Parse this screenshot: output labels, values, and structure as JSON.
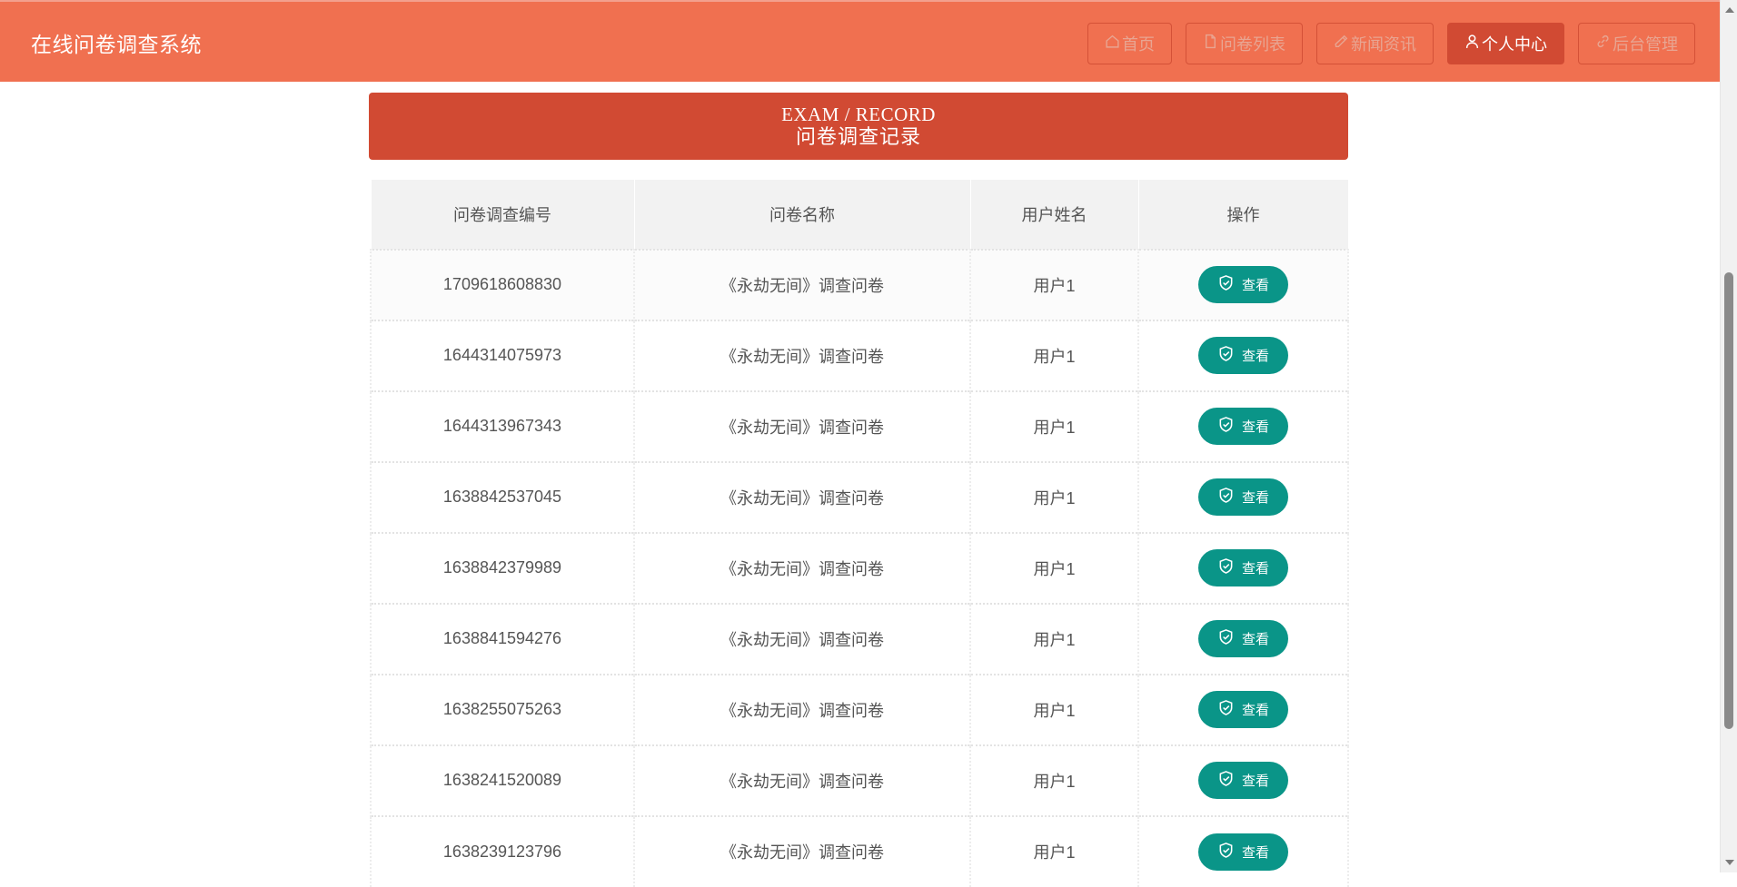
{
  "header": {
    "site_title": "在线问卷调查系统",
    "nav": [
      {
        "label": "首页",
        "icon": "home-icon",
        "active": false
      },
      {
        "label": "问卷列表",
        "icon": "document-icon",
        "active": false
      },
      {
        "label": "新闻资讯",
        "icon": "news-icon",
        "active": false
      },
      {
        "label": "个人中心",
        "icon": "user-icon",
        "active": true
      },
      {
        "label": "后台管理",
        "icon": "link-icon",
        "active": false
      }
    ]
  },
  "banner": {
    "title_en": "EXAM / RECORD",
    "title_cn": "问卷调查记录"
  },
  "table": {
    "columns": [
      "问卷调查编号",
      "问卷名称",
      "用户姓名",
      "操作"
    ],
    "rows": [
      {
        "id": "1709618608830",
        "name": "《永劫无间》调查问卷",
        "user": "用户1",
        "action": "查看"
      },
      {
        "id": "1644314075973",
        "name": "《永劫无间》调查问卷",
        "user": "用户1",
        "action": "查看"
      },
      {
        "id": "1644313967343",
        "name": "《永劫无间》调查问卷",
        "user": "用户1",
        "action": "查看"
      },
      {
        "id": "1638842537045",
        "name": "《永劫无间》调查问卷",
        "user": "用户1",
        "action": "查看"
      },
      {
        "id": "1638842379989",
        "name": "《永劫无间》调查问卷",
        "user": "用户1",
        "action": "查看"
      },
      {
        "id": "1638841594276",
        "name": "《永劫无间》调查问卷",
        "user": "用户1",
        "action": "查看"
      },
      {
        "id": "1638255075263",
        "name": "《永劫无间》调查问卷",
        "user": "用户1",
        "action": "查看"
      },
      {
        "id": "1638241520089",
        "name": "《永劫无间》调查问卷",
        "user": "用户1",
        "action": "查看"
      },
      {
        "id": "1638239123796",
        "name": "《永劫无间》调查问卷",
        "user": "用户1",
        "action": "查看"
      }
    ]
  },
  "colors": {
    "header_bg": "#f07050",
    "accent": "#d14a33",
    "view_button": "#0a9588"
  }
}
